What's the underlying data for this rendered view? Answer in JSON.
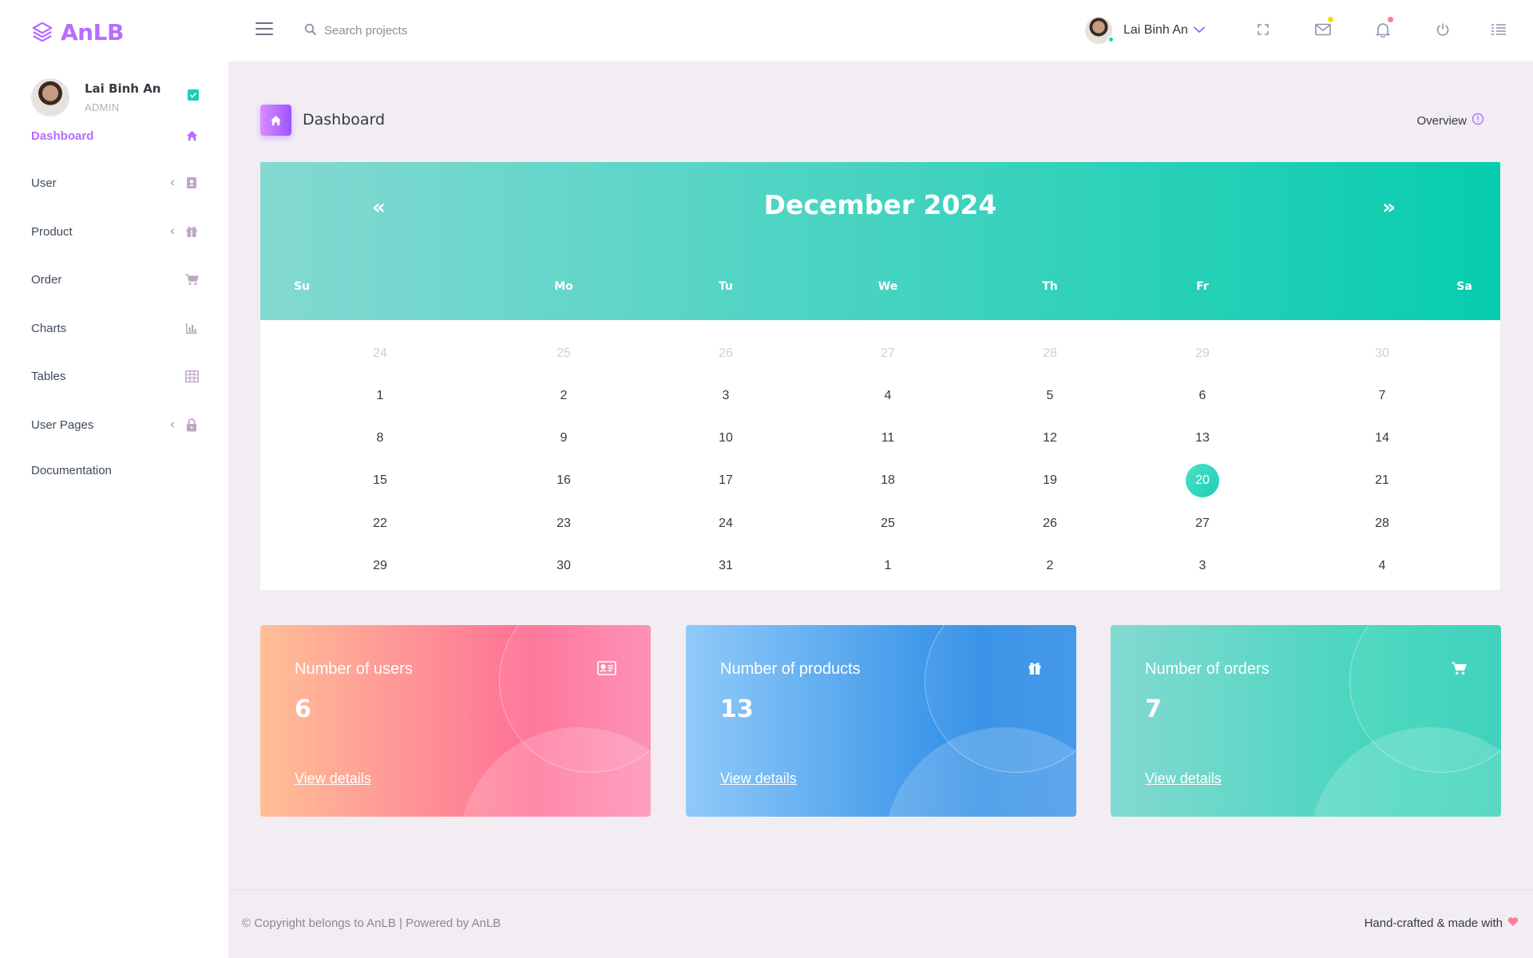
{
  "brand": {
    "name": "AnLB",
    "accent": "#b66dff"
  },
  "profile": {
    "name": "Lai Binh An",
    "role": "ADMIN",
    "badge_icon": "check-square-icon"
  },
  "sidebar": {
    "items": [
      {
        "label": "Dashboard",
        "icon": "home-icon",
        "active": true,
        "has_submenu": false
      },
      {
        "label": "User",
        "icon": "contacts-icon",
        "active": false,
        "has_submenu": true
      },
      {
        "label": "Product",
        "icon": "gift-icon",
        "active": false,
        "has_submenu": true
      },
      {
        "label": "Order",
        "icon": "cart-icon",
        "active": false,
        "has_submenu": false
      },
      {
        "label": "Charts",
        "icon": "chart-icon",
        "active": false,
        "has_submenu": false
      },
      {
        "label": "Tables",
        "icon": "table-icon",
        "active": false,
        "has_submenu": false
      },
      {
        "label": "User Pages",
        "icon": "lock-icon",
        "active": false,
        "has_submenu": true
      },
      {
        "label": "Documentation",
        "icon": "",
        "active": false,
        "has_submenu": false
      }
    ]
  },
  "topbar": {
    "search_placeholder": "Search projects",
    "user_name": "Lai Binh An",
    "icons": [
      "fullscreen-icon",
      "mail-icon",
      "bell-icon",
      "power-icon",
      "list-icon"
    ],
    "mail_dot_color": "#fed713",
    "bell_dot_color": "#fe7c96"
  },
  "page": {
    "title": "Dashboard",
    "overview_label": "Overview"
  },
  "calendar": {
    "title": "December 2024",
    "prev": "«",
    "next": "»",
    "weekdays": [
      "Su",
      "Mo",
      "Tu",
      "We",
      "Th",
      "Fr",
      "Sa"
    ],
    "weeks": [
      [
        "24",
        "25",
        "26",
        "27",
        "28",
        "29",
        "30"
      ],
      [
        "1",
        "2",
        "3",
        "4",
        "5",
        "6",
        "7"
      ],
      [
        "8",
        "9",
        "10",
        "11",
        "12",
        "13",
        "14"
      ],
      [
        "15",
        "16",
        "17",
        "18",
        "19",
        "20",
        "21"
      ],
      [
        "22",
        "23",
        "24",
        "25",
        "26",
        "27",
        "28"
      ],
      [
        "29",
        "30",
        "31",
        "1",
        "2",
        "3",
        "4"
      ]
    ],
    "selected_day": "20",
    "muted_week_index": 0
  },
  "stats": [
    {
      "label": "Number of users",
      "value": "6",
      "link": "View details",
      "icon": "id-card-icon"
    },
    {
      "label": "Number of products",
      "value": "13",
      "link": "View details",
      "icon": "gift-icon"
    },
    {
      "label": "Number of orders",
      "value": "7",
      "link": "View details",
      "icon": "cart-icon"
    }
  ],
  "footer": {
    "left": "© Copyright belongs to AnLB | Powered by AnLB",
    "right": "Hand-crafted & made with",
    "heart_color": "#fe7c96"
  }
}
